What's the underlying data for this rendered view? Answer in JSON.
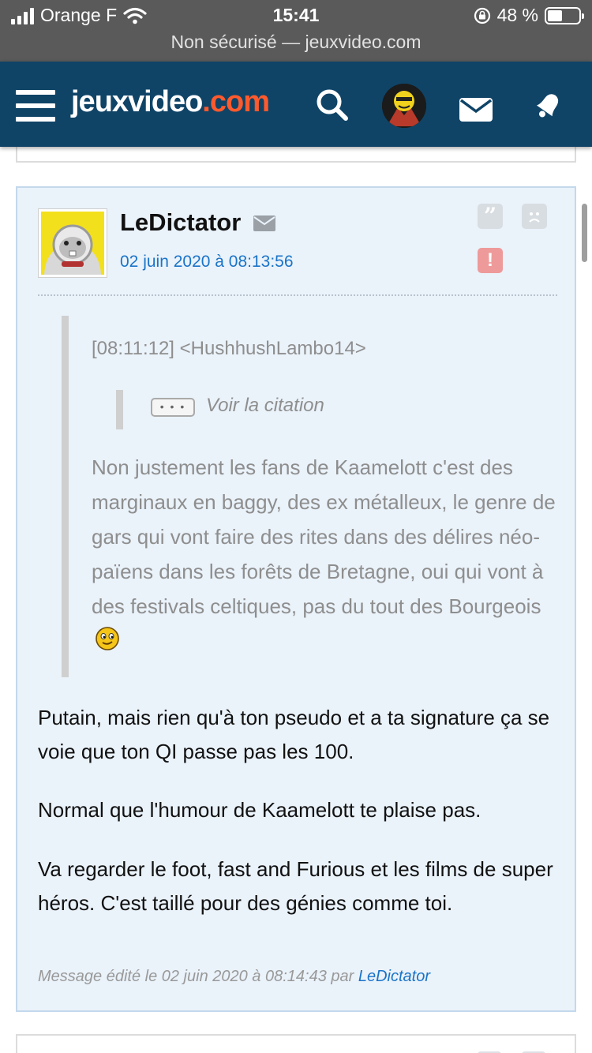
{
  "status_bar": {
    "carrier": "Orange F",
    "time": "15:41",
    "battery": "48 %",
    "battery_level": 0.48,
    "url": "Non sécurisé — jeuxvideo.com"
  },
  "header": {
    "logo_main": "jeuxvideo",
    "logo_dot": ".com",
    "icons": [
      "menu-icon",
      "search-icon",
      "user-avatar",
      "mail-icon",
      "bell-icon"
    ]
  },
  "post": {
    "pseudo": "LeDictator",
    "date": "02 juin 2020 à 08:13:56",
    "quote": {
      "header": "[08:11:12] <HushhushLambo14>",
      "inner_toggle": "• • •",
      "inner_label": "Voir la citation",
      "text": "Non justement les fans de Kaamelott c'est des marginaux en baggy, des ex métalleux, le genre de gars qui vont faire des rites dans des délires néo-païens dans les forêts de Bretagne, oui qui vont à des festivals celtiques, pas du tout des Bourgeois"
    },
    "paragraphs": [
      "Putain, mais rien qu'à ton pseudo et a ta signature ça se voie que ton QI passe pas les 100.",
      "Normal que l'humour de Kaamelott te plaise pas.",
      "Va regarder le foot, fast and Furious et les films de super héros. C'est taillé pour des génies comme toi."
    ],
    "edit_prefix": "Message édité le 02 juin 2020 à 08:14:43 par",
    "edit_author": "LeDictator"
  },
  "colors": {
    "header_bg": "#0f4467",
    "logo_accent": "#ff5a2d",
    "post_bg": "#eaf2fa",
    "link": "#1a74c8",
    "alert": "#ee9a9a"
  }
}
